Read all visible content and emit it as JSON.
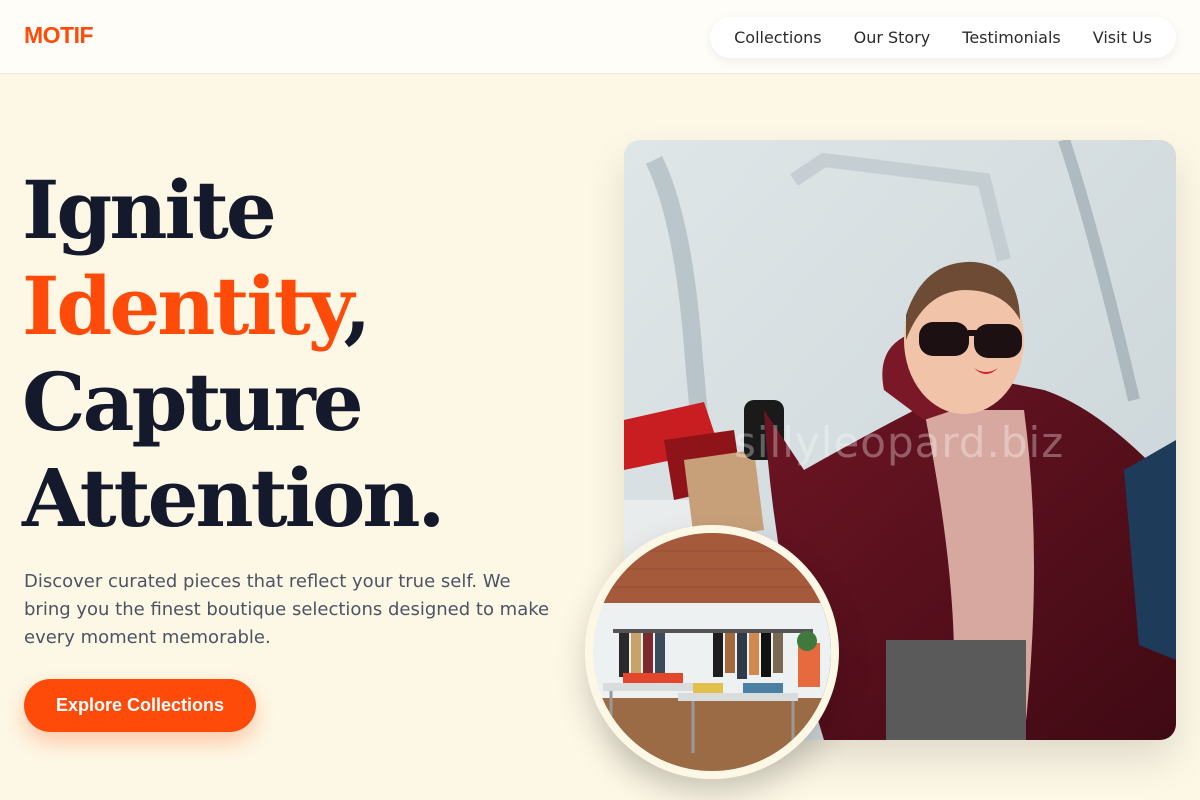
{
  "brand": {
    "logo": "MOTIF"
  },
  "nav": {
    "items": [
      {
        "label": "Collections"
      },
      {
        "label": "Our Story"
      },
      {
        "label": "Testimonials"
      },
      {
        "label": "Visit Us"
      }
    ]
  },
  "hero": {
    "headline": {
      "line1": "Ignite",
      "line2_accent": "Identity",
      "line2_punct": ",",
      "line3": "Capture",
      "line4": "Attention."
    },
    "description": "Discover curated pieces that reflect your true self. We bring you the finest boutique selections designed to make every moment memorable.",
    "cta_label": "Explore Collections"
  },
  "images": {
    "hero_watermark": "sillyleopard.biz"
  },
  "colors": {
    "accent": "#ff4b0a",
    "headline": "#141a2b",
    "background": "#fdf8e6",
    "body_text": "#4c5363"
  }
}
